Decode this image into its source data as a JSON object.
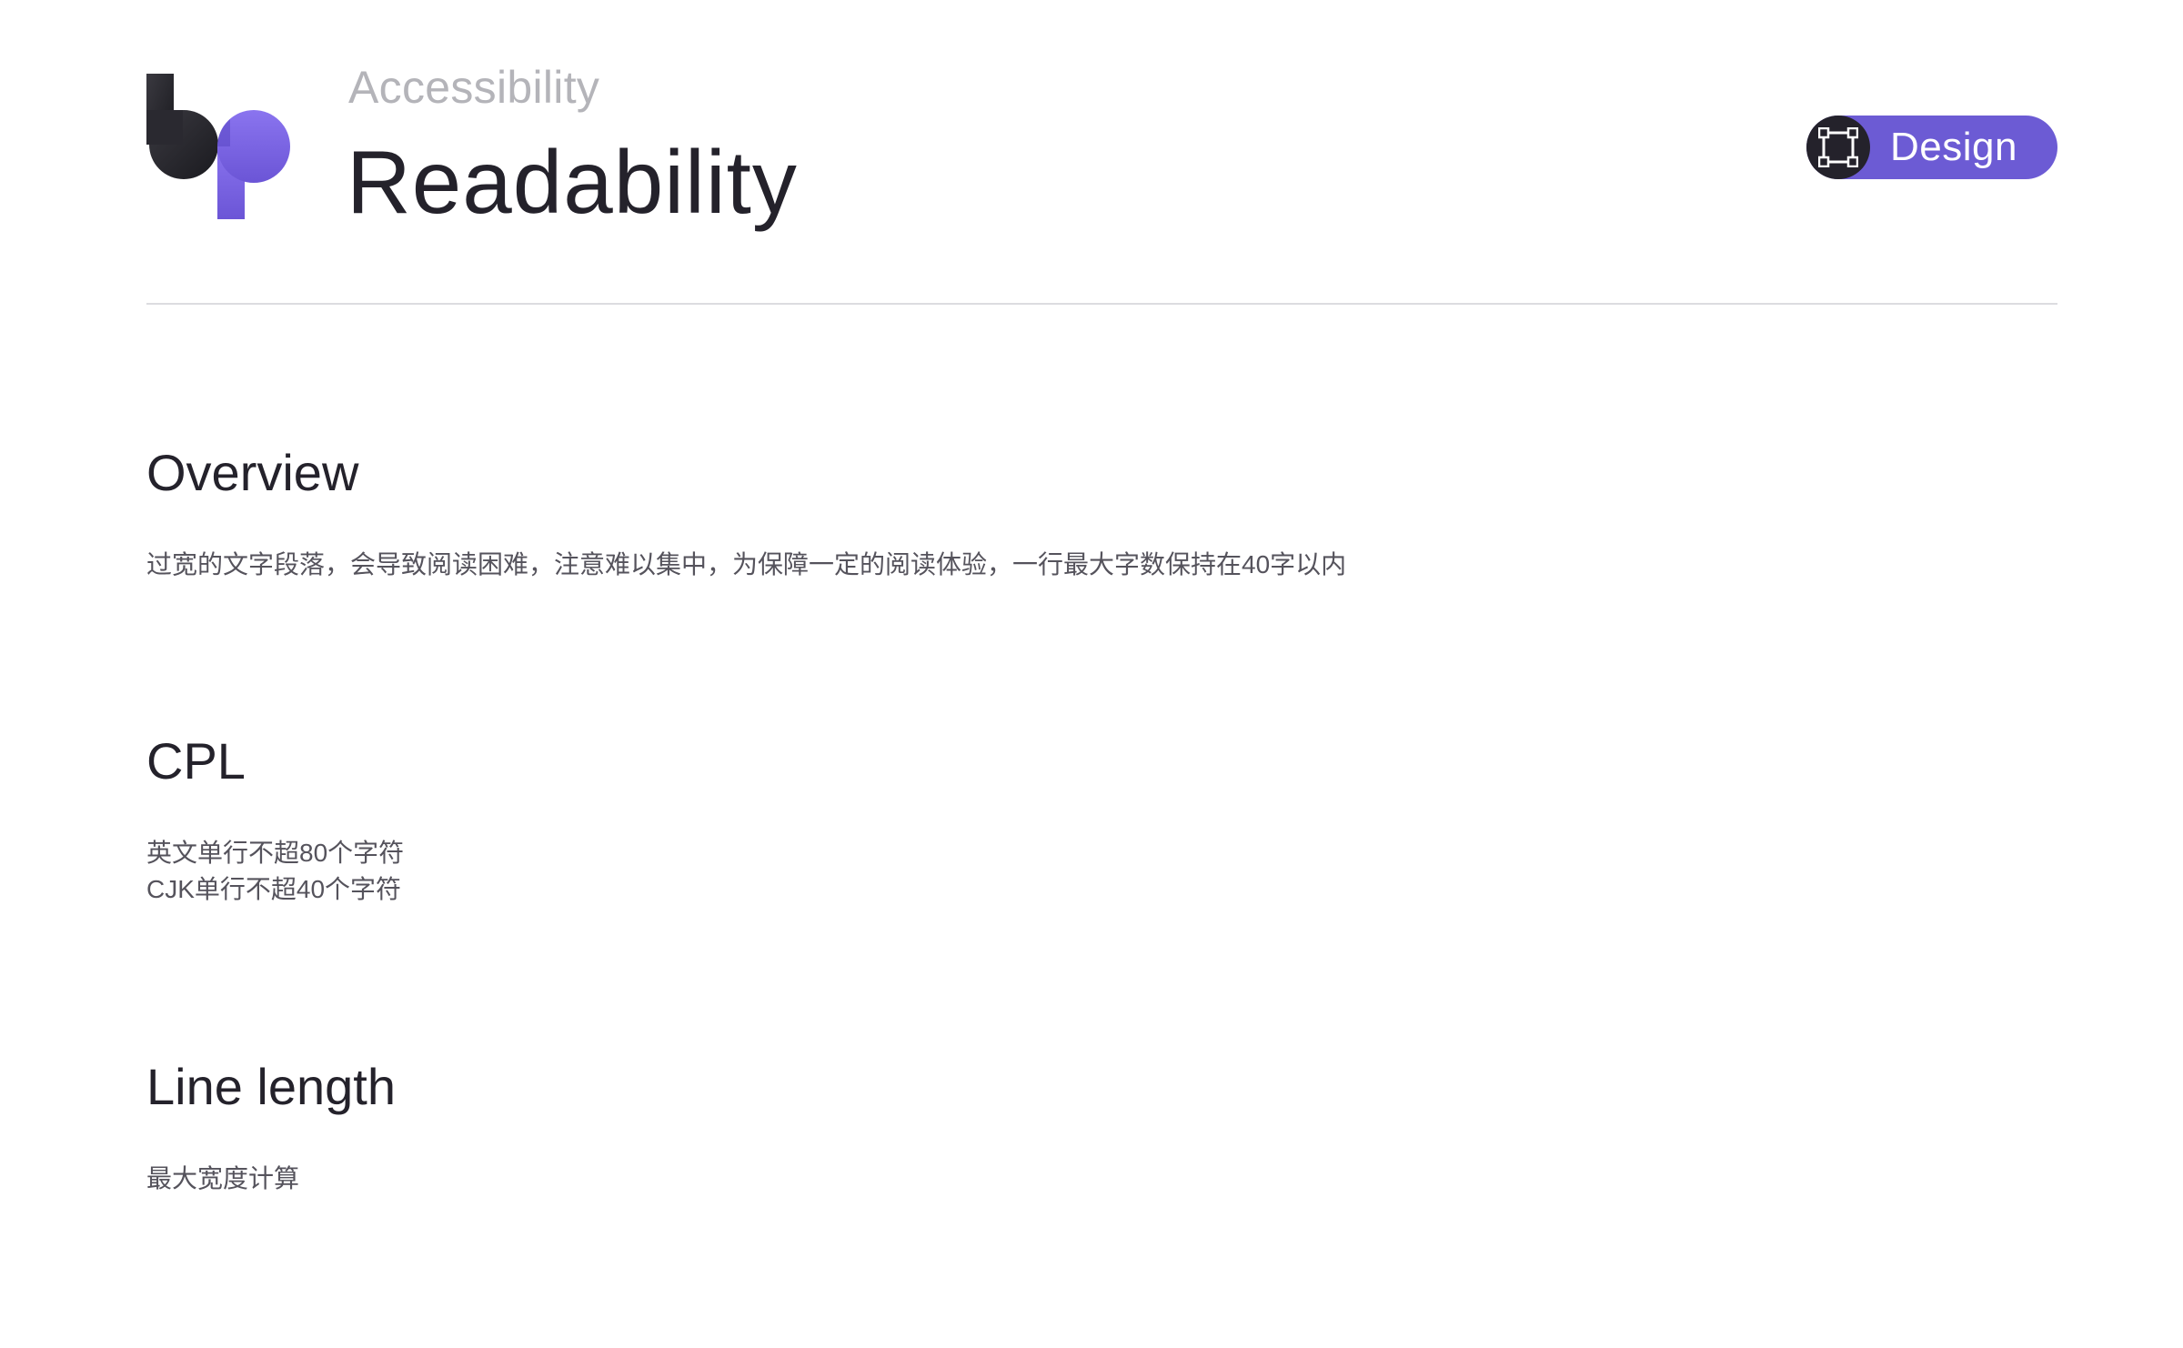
{
  "header": {
    "breadcrumb": "Accessibility",
    "title": "Readability",
    "badge": {
      "label": "Design",
      "icon": "frame-icon",
      "color": "#6c5bd4"
    },
    "logo": {
      "icon": "bp-logo",
      "colors": [
        "#24222b",
        "#7a64e6"
      ]
    }
  },
  "sections": [
    {
      "title": "Overview",
      "lines": [
        "过宽的文字段落，会导致阅读困难，注意难以集中，为保障一定的阅读体验，一行最大字数保持在40字以内"
      ]
    },
    {
      "title": "CPL",
      "lines": [
        "英文单行不超80个字符",
        "CJK单行不超40个字符"
      ]
    },
    {
      "title": "Line length",
      "lines": [
        "最大宽度计算"
      ]
    }
  ]
}
